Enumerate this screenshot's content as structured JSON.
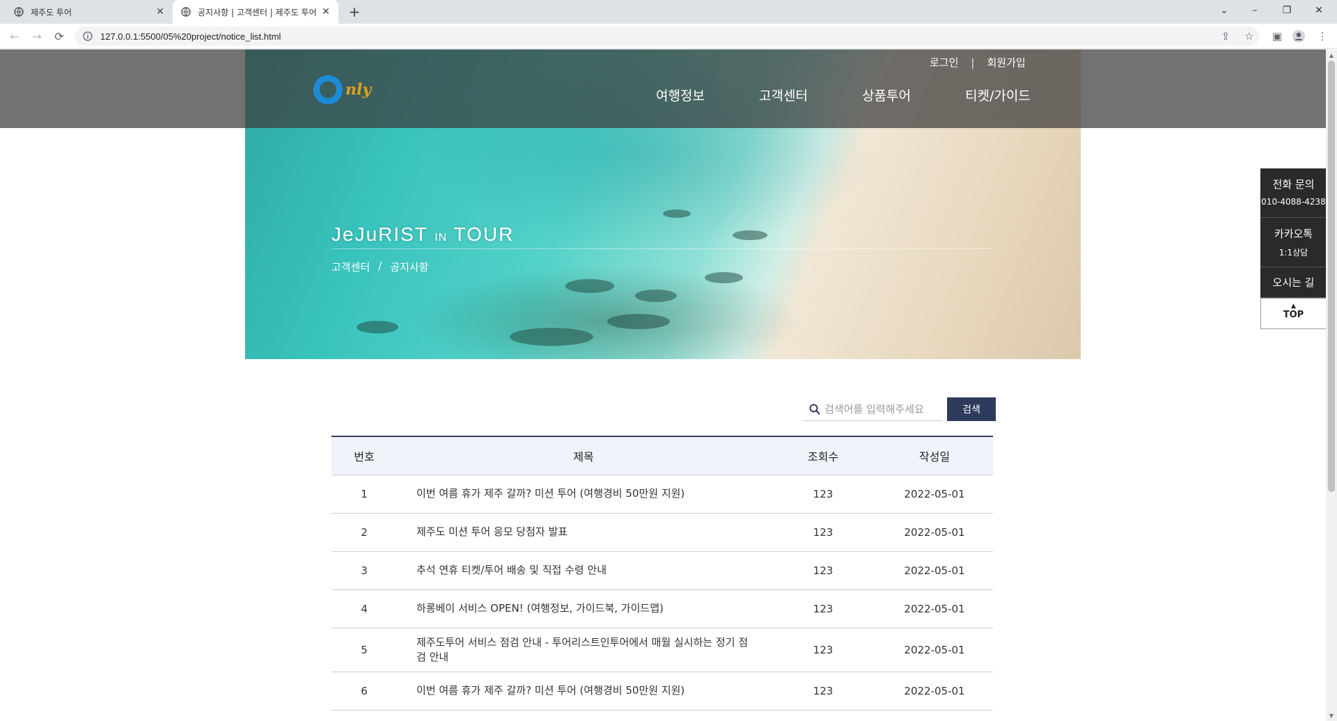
{
  "browser": {
    "tabs": [
      {
        "title": "제주도 투어",
        "active": false
      },
      {
        "title": "공지사항 | 고객센터 | 제주도 투어",
        "active": true
      }
    ],
    "url": "127.0.0.1:5500/05%20project/notice_list.html"
  },
  "header": {
    "logo_text": "nly",
    "util": {
      "login": "로그인",
      "separator": "|",
      "signup": "회원가입"
    },
    "nav": [
      "여행정보",
      "고객센터",
      "상품투어",
      "티켓/가이드"
    ]
  },
  "hero": {
    "title_main_1": "JeJuRIST",
    "title_small": "IN",
    "title_main_2": "TOUR",
    "breadcrumb": [
      "고객센터",
      "/",
      "공지사항"
    ]
  },
  "quick_menu": {
    "phone_label": "전화 문의",
    "phone_number": "010-4088-4238",
    "kakao_label": "카카오톡",
    "kakao_sub": "1:1상담",
    "directions": "오시는 길",
    "top": "TOP"
  },
  "search": {
    "placeholder": "검색어를 입력해주세요",
    "button": "검색"
  },
  "table": {
    "headers": [
      "번호",
      "제목",
      "조회수",
      "작성일"
    ],
    "rows": [
      {
        "no": "1",
        "title": "이번 여름 휴가 제주 갈까? 미션 투어 (여행경비 50만원 지원)",
        "views": "123",
        "date": "2022-05-01"
      },
      {
        "no": "2",
        "title": "제주도 미션 투어 응모 당첨자 발표",
        "views": "123",
        "date": "2022-05-01"
      },
      {
        "no": "3",
        "title": "추석 연휴 티켓/투어 배송 및 직접 수령 안내",
        "views": "123",
        "date": "2022-05-01"
      },
      {
        "no": "4",
        "title": "하롱베이 서비스 OPEN! (여행정보, 가이드북, 가이드맵)",
        "views": "123",
        "date": "2022-05-01"
      },
      {
        "no": "5",
        "title": "제주도투어 서비스 점검 안내 - 투어리스트인투어에서 매월 실시하는 정기 점검 안내",
        "views": "123",
        "date": "2022-05-01"
      },
      {
        "no": "6",
        "title": "이번 여름 휴가 제주 갈까? 미션 투어 (여행경비 50만원 지원)",
        "views": "123",
        "date": "2022-05-01"
      }
    ]
  }
}
